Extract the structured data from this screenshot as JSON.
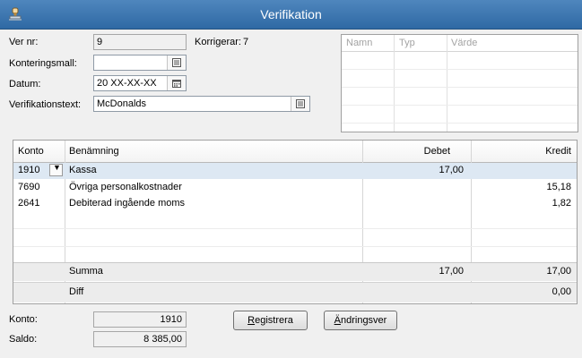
{
  "window": {
    "title": "Verifikation"
  },
  "form": {
    "ver_nr_label": "Ver nr:",
    "ver_nr_value": "9",
    "korrigerar_label": "Korrigerar:",
    "korrigerar_value": "7",
    "konteringsmall_label": "Konteringsmall:",
    "konteringsmall_value": "",
    "datum_label": "Datum:",
    "datum_value": "20 XX-XX-XX",
    "verifikationstext_label": "Verifikationstext:",
    "verifikationstext_value": "McDonalds"
  },
  "attributes": {
    "columns": [
      "Namn",
      "Typ",
      "Värde"
    ]
  },
  "grid": {
    "columns": {
      "konto": "Konto",
      "benamning": "Benämning",
      "debet": "Debet",
      "kredit": "Kredit"
    },
    "rows": [
      {
        "konto": "1910",
        "benamning": "Kassa",
        "debet": "17,00",
        "kredit": ""
      },
      {
        "konto": "7690",
        "benamning": "Övriga personalkostnader",
        "debet": "",
        "kredit": "15,18"
      },
      {
        "konto": "2641",
        "benamning": "Debiterad ingående moms",
        "debet": "",
        "kredit": "1,82"
      }
    ],
    "summa": {
      "label": "Summa",
      "debet": "17,00",
      "kredit": "17,00"
    },
    "diff": {
      "label": "Diff",
      "debet": "",
      "kredit": "0,00"
    }
  },
  "footer": {
    "konto_label": "Konto:",
    "konto_value": "1910",
    "saldo_label": "Saldo:",
    "saldo_value": "8 385,00",
    "registrera_first": "R",
    "registrera_rest": "egistrera",
    "andringsver_first": "Ä",
    "andringsver_rest": "ndringsver"
  },
  "colors": {
    "titlebar": "#3a74af",
    "selected_row": "#dde8f3"
  },
  "icons": {
    "app": "app-stamp-icon",
    "picker": "list-picker-icon",
    "calendar": "calendar-icon",
    "dropdown": "chevron-down-icon"
  }
}
